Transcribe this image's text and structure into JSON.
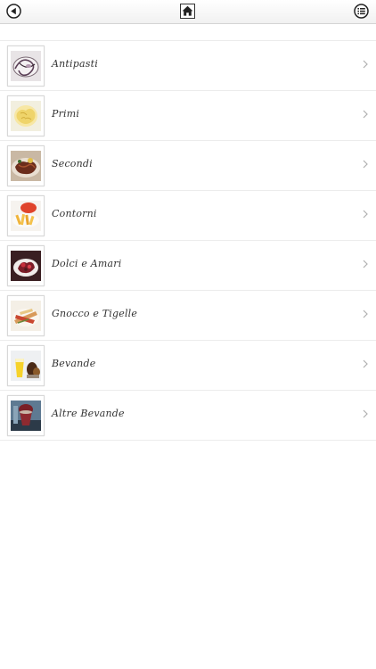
{
  "header": {
    "back_icon": "back-arrow-icon",
    "home_icon": "home-icon",
    "menu_icon": "list-menu-icon"
  },
  "menu": {
    "items": [
      {
        "label": "Antipasti",
        "thumb_icon": "antipasti-photo-icon"
      },
      {
        "label": "Primi",
        "thumb_icon": "primi-photo-icon"
      },
      {
        "label": "Secondi",
        "thumb_icon": "secondi-photo-icon"
      },
      {
        "label": "Contorni",
        "thumb_icon": "contorni-photo-icon"
      },
      {
        "label": "Dolci e Amari",
        "thumb_icon": "dolci-photo-icon"
      },
      {
        "label": "Gnocco e Tigelle",
        "thumb_icon": "gnocco-photo-icon"
      },
      {
        "label": "Bevande",
        "thumb_icon": "bevande-photo-icon"
      },
      {
        "label": "Altre Bevande",
        "thumb_icon": "altre-bevande-photo-icon"
      }
    ],
    "chevron_icon": "chevron-right-icon"
  },
  "colors": {
    "text": "#333333",
    "divider": "#ececec",
    "chevron": "#b0b0b0"
  }
}
